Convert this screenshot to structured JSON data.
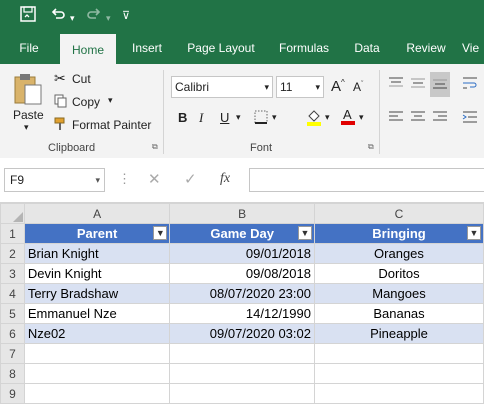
{
  "tabs": [
    {
      "label": "File"
    },
    {
      "label": "Home"
    },
    {
      "label": "Insert"
    },
    {
      "label": "Page Layout"
    },
    {
      "label": "Formulas"
    },
    {
      "label": "Data"
    },
    {
      "label": "Review"
    },
    {
      "label": "Vie"
    }
  ],
  "clipboard": {
    "paste": "Paste",
    "cut": "Cut",
    "copy": "Copy",
    "format_painter": "Format Painter",
    "group": "Clipboard"
  },
  "font": {
    "name": "Calibri",
    "size": "11",
    "group": "Font"
  },
  "formula_bar": {
    "name_box": "F9",
    "fx": "fx",
    "value": ""
  },
  "columns": [
    "A",
    "B",
    "C"
  ],
  "row_numbers": [
    "1",
    "2",
    "3",
    "4",
    "5",
    "6",
    "7",
    "8",
    "9"
  ],
  "table": {
    "headers": [
      "Parent",
      "Game Day",
      "Bringing"
    ],
    "rows": [
      [
        "Brian Knight",
        "09/01/2018",
        "Oranges"
      ],
      [
        "Devin Knight",
        "09/08/2018",
        "Doritos"
      ],
      [
        "Terry Bradshaw",
        "08/07/2020 23:00",
        "Mangoes"
      ],
      [
        "Emmanuel Nze",
        "14/12/1990",
        "Bananas"
      ],
      [
        "Nze02",
        "09/07/2020 03:02",
        "Pineapple"
      ]
    ]
  },
  "colors": {
    "excel_green": "#217346",
    "table_header": "#4472c4",
    "band": "#d9e1f2"
  }
}
